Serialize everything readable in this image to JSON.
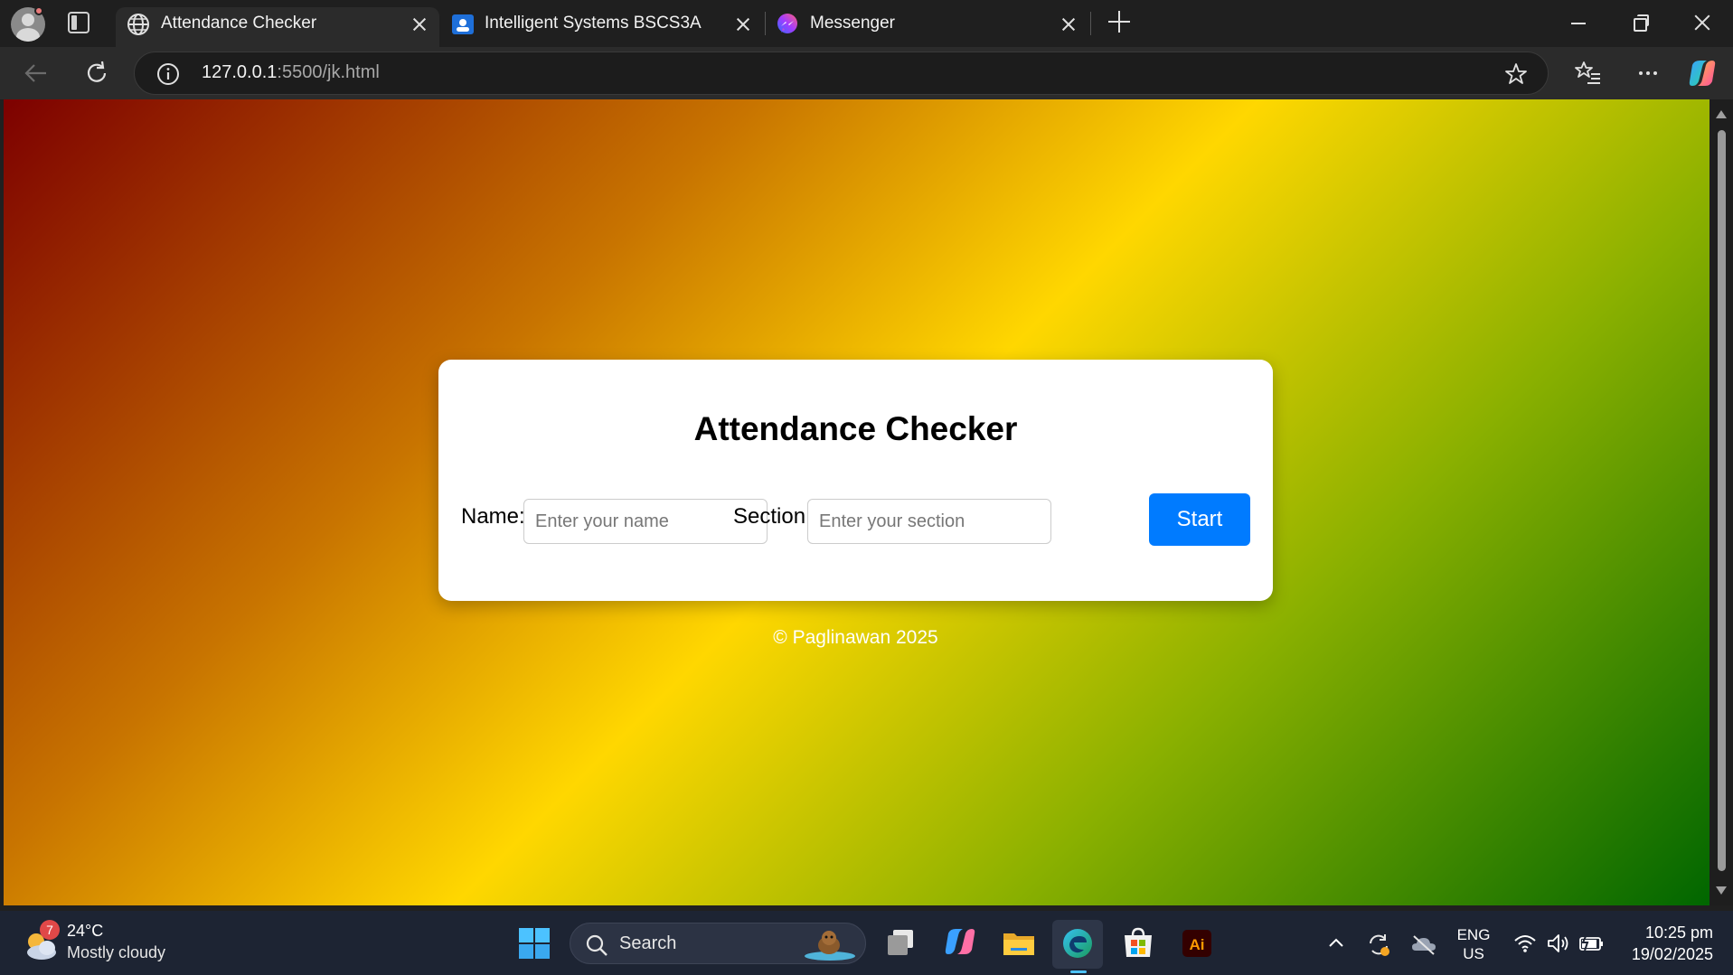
{
  "browser": {
    "tabs": [
      {
        "label": "Attendance Checker",
        "active": true,
        "icon": "globe-icon"
      },
      {
        "label": "Intelligent Systems BSCS3A",
        "active": false,
        "icon": "google-classroom-icon"
      },
      {
        "label": "Messenger",
        "active": false,
        "icon": "messenger-icon"
      }
    ],
    "address": {
      "host": "127.0.0.1",
      "path": ":5500/jk.html"
    }
  },
  "page": {
    "title": "Attendance Checker",
    "name_label": "Name:",
    "name_placeholder": "Enter your name",
    "section_label": "Section:",
    "section_placeholder": "Enter your section",
    "start_label": "Start",
    "footer": "© Paglinawan 2025",
    "colors": {
      "gradient": [
        "#7d0000",
        "#c87400",
        "#ffd700",
        "#8ab000",
        "#006600"
      ],
      "button": "#007bff"
    }
  },
  "taskbar": {
    "weather": {
      "badge": "7",
      "temp": "24°C",
      "condition": "Mostly cloudy"
    },
    "search_label": "Search",
    "language": {
      "lang": "ENG",
      "region": "US"
    },
    "clock": {
      "time": "10:25 pm",
      "date": "19/02/2025"
    },
    "apps": [
      "start-icon",
      "task-view-icon",
      "copilot-icon",
      "file-explorer-icon",
      "edge-icon",
      "microsoft-store-icon",
      "illustrator-icon"
    ]
  }
}
